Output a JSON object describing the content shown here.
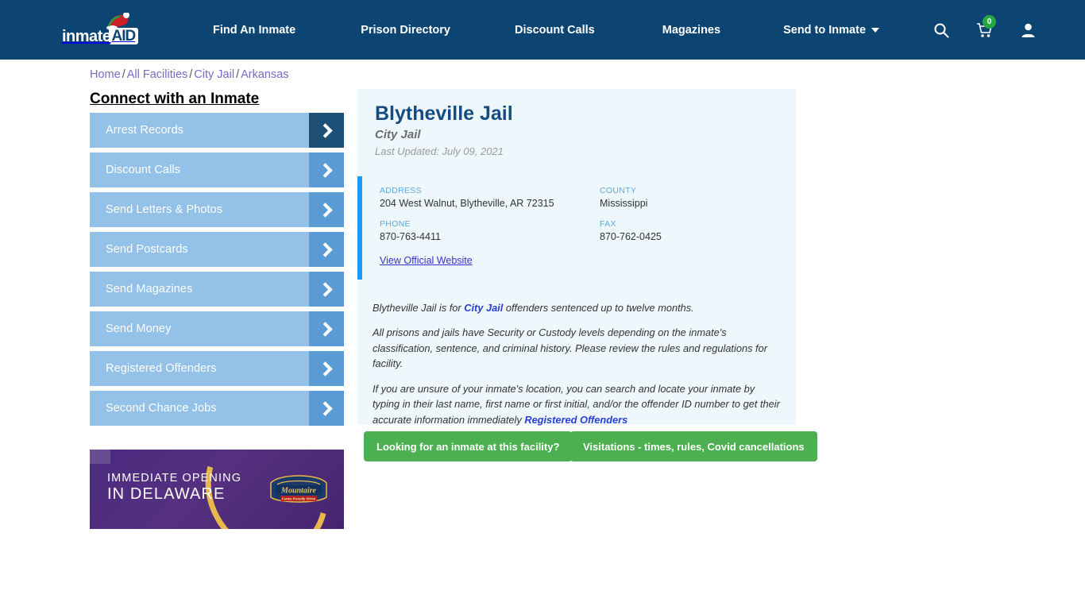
{
  "navbar": {
    "logo_text": "inmate",
    "logo_badge": "AID",
    "links": [
      {
        "label": "Find An Inmate"
      },
      {
        "label": "Prison Directory"
      },
      {
        "label": "Discount Calls"
      },
      {
        "label": "Magazines"
      },
      {
        "label": "Send to Inmate"
      }
    ],
    "cart_count": "0",
    "background_color": "#0c4472"
  },
  "breadcrumb": {
    "items": [
      "Home",
      "All Facilities",
      "City Jail",
      "Arkansas"
    ],
    "separator": "/"
  },
  "sidebar": {
    "title": "Connect with an Inmate",
    "items": [
      {
        "label": "Arrest Records",
        "active": true
      },
      {
        "label": "Discount Calls",
        "active": false
      },
      {
        "label": "Send Letters & Photos",
        "active": false
      },
      {
        "label": "Send Postcards",
        "active": false
      },
      {
        "label": "Send Magazines",
        "active": false
      },
      {
        "label": "Send Money",
        "active": false
      },
      {
        "label": "Registered Offenders",
        "active": false
      },
      {
        "label": "Second Chance Jobs",
        "active": false
      }
    ]
  },
  "ad": {
    "line1": "IMMEDIATE OPENING",
    "line2": "IN DELAWARE",
    "brand": "Mountaire",
    "brand_tagline": "Farms Proudly Strive"
  },
  "facility": {
    "name": "Blytheville Jail",
    "type": "City Jail",
    "last_updated": "Last Updated: July 09, 2021",
    "fields": [
      {
        "label": "ADDRESS",
        "value": "204 West Walnut, Blytheville, AR 72315"
      },
      {
        "label": "COUNTY",
        "value": "Mississippi"
      },
      {
        "label": "PHONE",
        "value": "870-763-4411"
      },
      {
        "label": "FAX",
        "value": "870-762-0425"
      }
    ],
    "website_link": "View Official Website",
    "paragraphs": {
      "p1_a": "Blytheville Jail is for ",
      "p1_link": "City Jail",
      "p1_b": " offenders sentenced up to twelve months.",
      "p2": "All prisons and jails have Security or Custody levels depending on the inmate's classification, sentence, and criminal history. Please review the rules and regulations for facility.",
      "p3_a": "If you are unsure of your inmate's location, you can search and locate your inmate by typing in their last name, first name or first initial, and/or the offender ID number to get their accurate information immediately ",
      "p3_link": "Registered Offenders"
    }
  },
  "buttons": {
    "inmate_search": "Looking for an inmate at this facility?",
    "visitations": "Visitations - times, rules, Covid cancellations",
    "color": "#4caf50"
  },
  "colors": {
    "accent_blue": "#2196f3",
    "card_bg": "#eef7fc",
    "title_navy": "#154c80",
    "sidebar_item": "#94c1e8",
    "sidebar_arrow": "#5b9bd5",
    "sidebar_arrow_active": "#1d4f77"
  }
}
